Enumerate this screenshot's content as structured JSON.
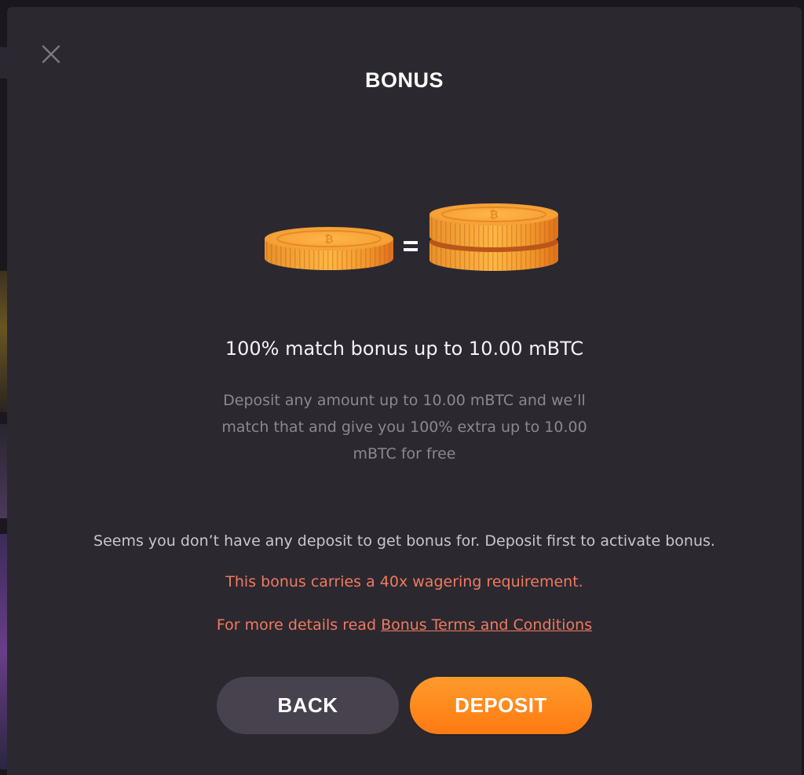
{
  "modal": {
    "title": "BONUS",
    "close_icon": "close-icon",
    "illustration_icon": "coins-equals-double-coins-icon",
    "equals_sign": "=",
    "headline": "100% match bonus up to 10.00 mBTC",
    "description": "Deposit any amount up to 10.00 mBTC and we’ll match that and give you 100% extra up to 10.00 mBTC for free",
    "notice": "Seems you don’t have any deposit to get bonus for. Deposit first to activate bonus.",
    "wagering": "This bonus carries a 40x wagering requirement.",
    "terms_prefix": "For more details read ",
    "terms_link": "Bonus Terms and Conditions",
    "back_label": "BACK",
    "deposit_label": "DEPOSIT"
  },
  "colors": {
    "modal_background": "#2b2830",
    "accent_orange": "#ff8a1e",
    "warning_text": "#f07a5e",
    "back_button": "#47424e",
    "coin_gold": "#f2a233"
  }
}
